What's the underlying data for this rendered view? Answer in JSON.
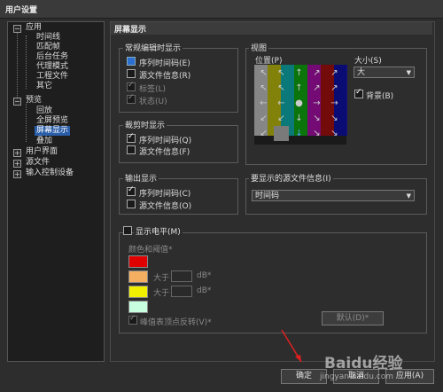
{
  "window_title": "用户设置",
  "tree": [
    {
      "label": "应用",
      "expander": "−"
    },
    {
      "label": "时间线"
    },
    {
      "label": "匹配帧"
    },
    {
      "label": "后台任务"
    },
    {
      "label": "代理模式"
    },
    {
      "label": "工程文件"
    },
    {
      "label": "其它"
    },
    {
      "label": "预览",
      "expander": "−"
    },
    {
      "label": "回放"
    },
    {
      "label": "全屏预览"
    },
    {
      "label": "屏幕显示"
    },
    {
      "label": "叠加"
    },
    {
      "label": "用户界面",
      "expander": "+"
    },
    {
      "label": "源文件",
      "expander": "+"
    },
    {
      "label": "输入控制设备",
      "expander": "+"
    }
  ],
  "panel_title": "屏幕显示",
  "normal_edit": {
    "title": "常规编辑时显示",
    "items": [
      {
        "label": "序列时间码(E)",
        "checked": false,
        "highlight": true
      },
      {
        "label": "源文件信息(R)",
        "checked": false
      },
      {
        "label": "标签(L)",
        "checked": true,
        "disabled": true
      },
      {
        "label": "状态(U)",
        "checked": true,
        "disabled": true
      }
    ]
  },
  "trim": {
    "title": "裁剪时显示",
    "items": [
      {
        "label": "序列时间码(Q)",
        "checked": true
      },
      {
        "label": "源文件信息(F)",
        "checked": false
      }
    ]
  },
  "output": {
    "title": "输出显示",
    "items": [
      {
        "label": "序列时间码(C)",
        "checked": true
      },
      {
        "label": "源文件信息(O)",
        "checked": false
      }
    ]
  },
  "view": {
    "title": "视图",
    "position_label": "位置(P)",
    "size_label": "大小(S)",
    "size_value": "大",
    "background_label": "背景(B)",
    "background_checked": true,
    "color_bars": [
      "#e0e0e0",
      "#d8d800",
      "#00c8c8",
      "#00c000",
      "#c000c0",
      "#c00000",
      "#0000c0"
    ]
  },
  "source_info": {
    "title": "要显示的源文件信息(I)",
    "value": "时间码"
  },
  "level_meter": {
    "title": "显示电平(M)",
    "checked": false,
    "color_threshold_label": "颜色和阈值*",
    "above_label": "大于",
    "unit": "dB*",
    "swatches": [
      "#e00000",
      "#f4b060",
      "#f0f000",
      "#c8ffe0"
    ],
    "peak_label": "峰值表顶点反转(V)*",
    "peak_checked": true,
    "default_button": "默认(D)*"
  },
  "footer": {
    "ok": "确定",
    "cancel": "取消",
    "apply": "应用(A)"
  },
  "watermark": "Baidu经验 jingyan.baidu.com"
}
